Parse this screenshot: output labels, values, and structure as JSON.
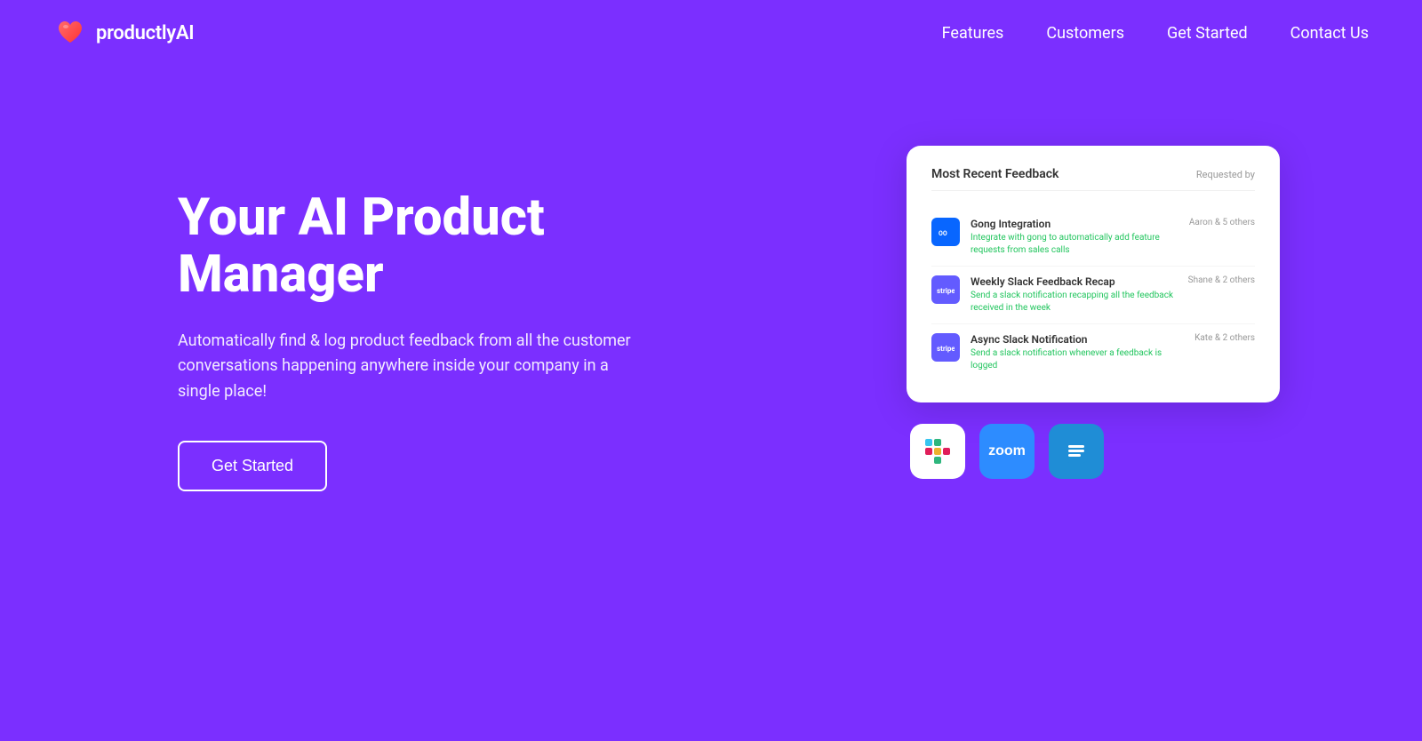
{
  "brand": {
    "name": "productlyAI",
    "logo_alt": "productlyAI heart logo"
  },
  "nav": {
    "links": [
      {
        "label": "Features",
        "id": "features"
      },
      {
        "label": "Customers",
        "id": "customers"
      },
      {
        "label": "Get Started",
        "id": "get-started"
      },
      {
        "label": "Contact Us",
        "id": "contact-us"
      }
    ]
  },
  "hero": {
    "title": "Your AI Product Manager",
    "subtitle": "Automatically find & log product feedback from all the customer conversations happening anywhere inside your company in a single place!",
    "cta_label": "Get Started"
  },
  "feedback_card": {
    "title": "Most Recent Feedback",
    "header_right": "Requested by",
    "items": [
      {
        "company": "Meta",
        "logo_type": "meta",
        "name": "Gong Integration",
        "description": "Integrate with gong to automatically add feature requests from sales calls",
        "requestors": "Aaron & 5 others"
      },
      {
        "company": "Stripe",
        "logo_type": "stripe",
        "name": "Weekly Slack Feedback Recap",
        "description": "Send a slack notification recapping all the feedback received in the week",
        "requestors": "Shane & 2 others"
      },
      {
        "company": "Stripe",
        "logo_type": "stripe",
        "name": "Async Slack Notification",
        "description": "Send a slack notification whenever a feedback is logged",
        "requestors": "Kate & 2 others"
      }
    ]
  },
  "integrations": [
    {
      "name": "Slack",
      "type": "slack"
    },
    {
      "name": "Zoom",
      "type": "zoom"
    },
    {
      "name": "Intercom",
      "type": "intercom"
    }
  ],
  "colors": {
    "background": "#7B2FFF",
    "white": "#FFFFFF",
    "card_bg": "#FFFFFF"
  }
}
